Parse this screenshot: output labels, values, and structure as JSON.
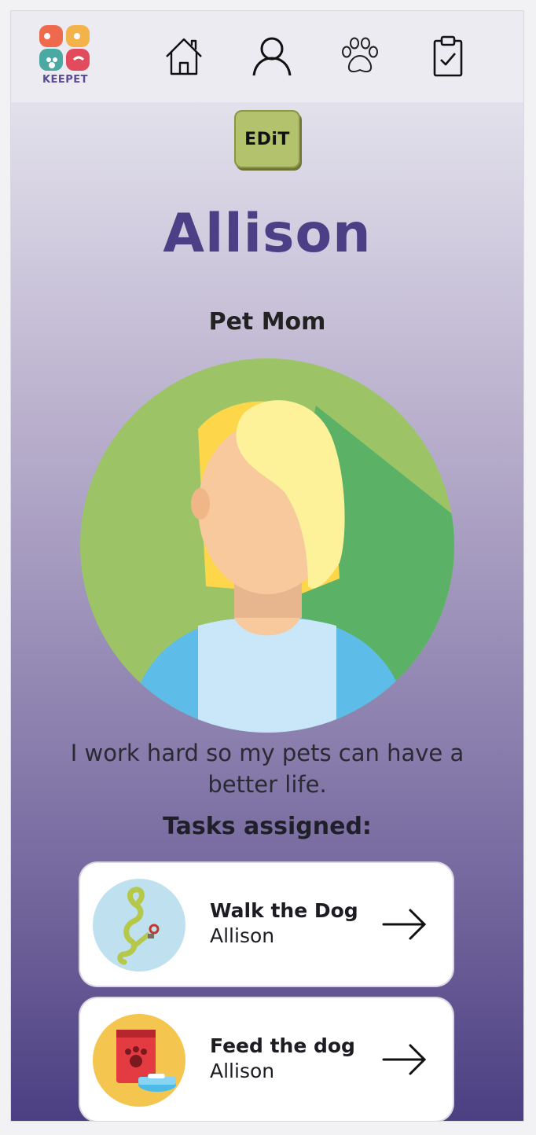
{
  "header": {
    "logo_text": "KEEPET",
    "nav": [
      {
        "icon": "home-icon"
      },
      {
        "icon": "profile-icon"
      },
      {
        "icon": "paw-icon"
      },
      {
        "icon": "clipboard-check-icon"
      }
    ]
  },
  "profile": {
    "edit_label": "EDiT",
    "name": "Allison",
    "role": "Pet Mom",
    "bio": "I work hard so my pets can have a better life."
  },
  "tasks": {
    "heading": "Tasks assigned:",
    "items": [
      {
        "title": "Walk the Dog",
        "assignee": "Allison",
        "icon": "leash-icon"
      },
      {
        "title": "Feed the dog",
        "assignee": "Allison",
        "icon": "pet-food-icon"
      }
    ]
  },
  "colors": {
    "accent_green": "#b3c26c",
    "name_purple": "#4c3f86",
    "gradient_top": "#e3e1ec",
    "gradient_bottom": "#4c3f82"
  }
}
